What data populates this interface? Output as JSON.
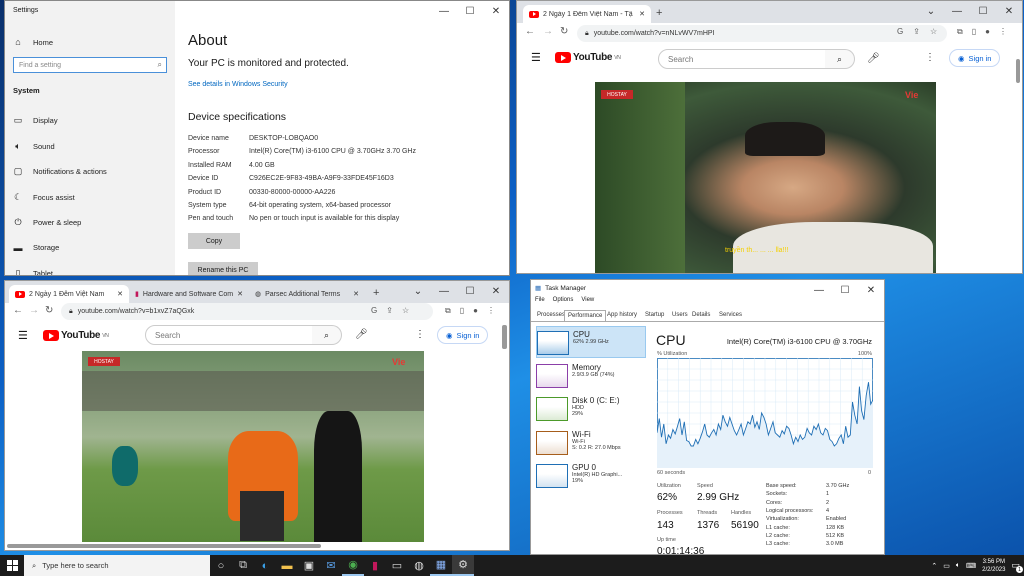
{
  "settings": {
    "title": "Settings",
    "home": "Home",
    "search_placeholder": "Find a setting",
    "section": "System",
    "nav": [
      {
        "label": "Display",
        "icon": "display-icon"
      },
      {
        "label": "Sound",
        "icon": "sound-icon"
      },
      {
        "label": "Notifications & actions",
        "icon": "notifications-icon"
      },
      {
        "label": "Focus assist",
        "icon": "focus-assist-icon"
      },
      {
        "label": "Power & sleep",
        "icon": "power-icon"
      },
      {
        "label": "Storage",
        "icon": "storage-icon"
      },
      {
        "label": "Tablet",
        "icon": "tablet-icon"
      }
    ],
    "about_title": "About",
    "protected": "Your PC is monitored and protected.",
    "security_link": "See details in Windows Security",
    "specs_title": "Device specifications",
    "specs": [
      [
        "Device name",
        "DESKTOP-LOBQAO0"
      ],
      [
        "Processor",
        "Intel(R) Core(TM) i3-6100 CPU @ 3.70GHz   3.70 GHz"
      ],
      [
        "Installed RAM",
        "4.00 GB"
      ],
      [
        "Device ID",
        "C926EC2E-9F83-49BA-A9F9-33FDE45F16D3"
      ],
      [
        "Product ID",
        "00330-80000-00000-AA226"
      ],
      [
        "System type",
        "64-bit operating system, x64-based processor"
      ],
      [
        "Pen and touch",
        "No pen or touch input is available for this display"
      ]
    ],
    "copy": "Copy",
    "rename": "Rename this PC"
  },
  "chrome_right": {
    "tab": "2 Ngày 1 Đêm Việt Nam - Tậ",
    "url": "youtube.com/watch?v=nNLvWV7mHPI",
    "search": "Search",
    "signin": "Sign in",
    "vn": "VN",
    "subtitle": "truyền th... ... ... lla!!!"
  },
  "chrome_left": {
    "tabs": [
      "2 Ngày 1 Đêm Việt Nam",
      "Hardware and Software Com",
      "Parsec Additional Terms"
    ],
    "url": "youtube.com/watch?v=b1xvZ7aQGxk",
    "search": "Search",
    "signin": "Sign in",
    "vn": "VN"
  },
  "tm": {
    "title": "Task Manager",
    "menu": [
      "File",
      "Options",
      "View"
    ],
    "tabs": [
      "Processes",
      "Performance",
      "App history",
      "Startup",
      "Users",
      "Details",
      "Services"
    ],
    "resources": [
      {
        "name": "CPU",
        "l1": "62% 2.99 GHz",
        "l2": "",
        "color": "#1f6fb5"
      },
      {
        "name": "Memory",
        "l1": "2.9/3.9 GB (74%)",
        "l2": "",
        "color": "#8b3fa8"
      },
      {
        "name": "Disk 0 (C: E:)",
        "l1": "HDD",
        "l2": "29%",
        "color": "#4c9a2a"
      },
      {
        "name": "Wi-Fi",
        "l1": "Wi-Fi",
        "l2": "S: 0.2  R: 27.0 Mbps",
        "color": "#a65d1b"
      },
      {
        "name": "GPU 0",
        "l1": "Intel(R) HD Graphi...",
        "l2": "19%",
        "color": "#1f6fb5"
      }
    ],
    "cpu_title": "CPU",
    "cpu_model": "Intel(R) Core(TM) i3-6100 CPU @ 3.70GHz",
    "util_label": "% Utilization",
    "util_max": "100%",
    "time_label": "60 seconds",
    "time_end": "0",
    "stats": {
      "utilization": "62%",
      "speed": "2.99 GHz",
      "processes": "143",
      "threads": "1376",
      "handles": "56190",
      "uptime": "0:01:14:36"
    },
    "stat_labels": {
      "utilization": "Utilization",
      "speed": "Speed",
      "processes": "Processes",
      "threads": "Threads",
      "handles": "Handles",
      "uptime": "Up time"
    },
    "specs": [
      [
        "Base speed:",
        "3.70 GHz"
      ],
      [
        "Sockets:",
        "1"
      ],
      [
        "Cores:",
        "2"
      ],
      [
        "Logical processors:",
        "4"
      ],
      [
        "Virtualization:",
        "Enabled"
      ],
      [
        "L1 cache:",
        "128 KB"
      ],
      [
        "L2 cache:",
        "512 KB"
      ],
      [
        "L3 cache:",
        "3.0 MB"
      ]
    ],
    "cpu_history": [
      32,
      45,
      28,
      40,
      22,
      30,
      27,
      35,
      31,
      38,
      45,
      30,
      42,
      25,
      24,
      20,
      20,
      26,
      22,
      27,
      33,
      40,
      30,
      28,
      32,
      35,
      30,
      40,
      35,
      48,
      42,
      38,
      46,
      40,
      34,
      30,
      35,
      40,
      30,
      36,
      42,
      40,
      48,
      37,
      42,
      35,
      50,
      46,
      40,
      30,
      36,
      42,
      32,
      30,
      28,
      34,
      31,
      38,
      36,
      30,
      22,
      28,
      24,
      30,
      26,
      28,
      36,
      32,
      30,
      38,
      35,
      40,
      32,
      30,
      36,
      34,
      26,
      24,
      20,
      22,
      27,
      30,
      22,
      38,
      28,
      30,
      60,
      48,
      40,
      74,
      52,
      44,
      66,
      78,
      58,
      62
    ]
  },
  "taskbar": {
    "search_placeholder": "Type here to search",
    "time": "3:56 PM",
    "date": "2/2/2023",
    "badge": "1"
  }
}
